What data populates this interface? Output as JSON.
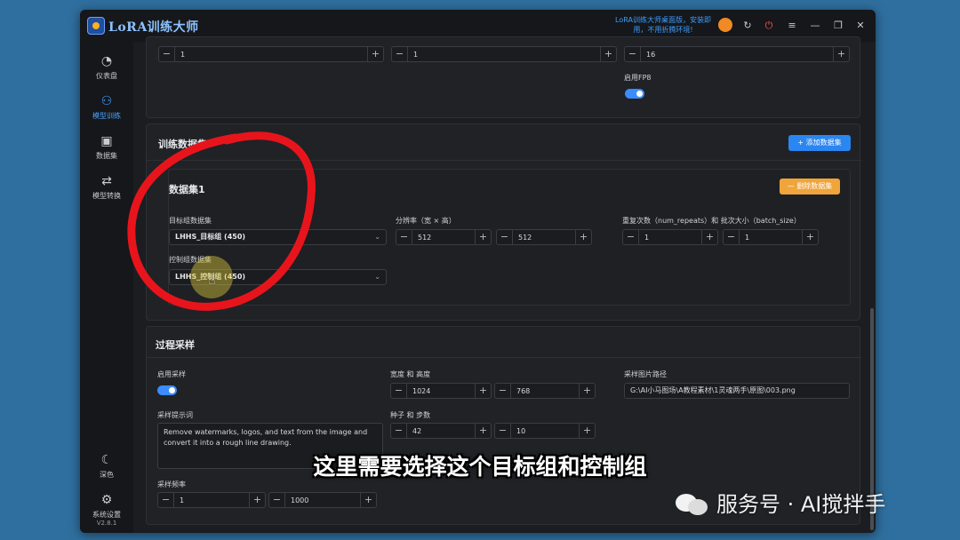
{
  "app": {
    "title": "LoRA训练大师",
    "notice": "LoRA训练大师桌面版，安装即用，不用折腾环境!"
  },
  "titlebar_icons": [
    "avatar-icon",
    "refresh-icon",
    "power-icon",
    "menu-icon",
    "minimize-icon",
    "maximize-icon",
    "close-icon"
  ],
  "sidebar": {
    "items": [
      {
        "label": "仪表盘",
        "icon": "dashboard-icon"
      },
      {
        "label": "模型训练",
        "icon": "network-icon",
        "active": true
      },
      {
        "label": "数据集",
        "icon": "images-icon"
      },
      {
        "label": "模型转换",
        "icon": "convert-icon"
      }
    ],
    "theme_label": "深色",
    "settings_label": "系统设置",
    "version": "V2.8.1"
  },
  "top_section": {
    "steppers": [
      "1",
      "1",
      "16"
    ],
    "fp8_label": "启用FP8",
    "fp8_enabled": true
  },
  "dataset_section": {
    "title": "训练数据集",
    "add_button": "+ 添加数据集",
    "dataset": {
      "title": "数据集1",
      "delete_button": "— 删除数据集",
      "target_label": "目标组数据集",
      "target_value": "LHHS_目标组 (450)",
      "control_label": "控制组数据集",
      "control_value": "LHHS_控制组 (450)",
      "resolution_label": "分辨率（宽 × 高）",
      "res_w": "512",
      "res_h": "512",
      "repeat_label": "重复次数（num_repeats）和 批次大小（batch_size）",
      "repeats": "1",
      "batch": "1"
    }
  },
  "sampling_section": {
    "title": "过程采样",
    "enable_label": "启用采样",
    "enabled": true,
    "size_label": "宽度 和 高度",
    "width": "1024",
    "height": "768",
    "path_label": "采样图片路径",
    "path_value": "G:\\AI小马图场\\A教程素材\\1灵魂两手\\原图\\003.png",
    "prompt_label": "采样提示词",
    "prompt_value": "Remove watermarks, logos, and text from the image and convert it into a rough line drawing.",
    "seed_label": "种子 和 步数",
    "seed": "42",
    "steps": "10",
    "freq_label": "采样频率",
    "freq": "1",
    "freq_total": "1000"
  },
  "subtitle": "这里需要选择这个目标组和控制组",
  "watermark": "服务号 · AI搅拌手",
  "colors": {
    "accent": "#2a86f0",
    "danger_button": "#f0a43a",
    "annotation": "#e8141c",
    "sidebar_active": "#4aa0ff"
  }
}
